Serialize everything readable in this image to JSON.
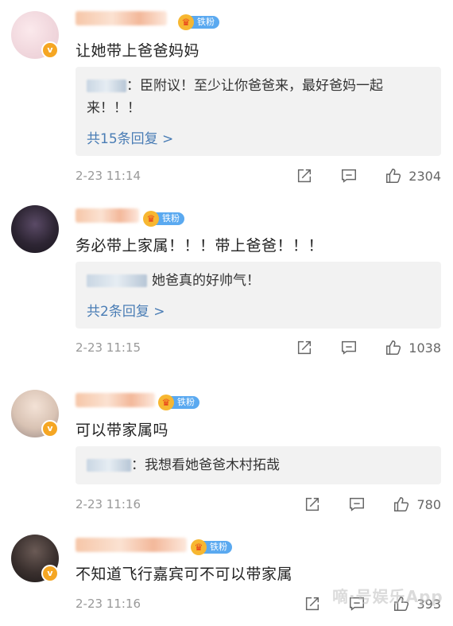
{
  "comments": [
    {
      "fan_badge": "铁粉",
      "text": "让她带上爸爸妈妈",
      "reply_preview": "：臣附议！至少让你爸爸来，最好爸妈一起",
      "reply_preview_cont": "来！！！",
      "reply_count": "共15条回复 >",
      "time": "2-23 11:14",
      "likes": "2304"
    },
    {
      "fan_badge": "铁粉",
      "text": "务必带上家属！！！带上爸爸！！！",
      "reply_preview": "她爸真的好帅气！",
      "reply_count": "共2条回复 >",
      "time": "2-23 11:15",
      "likes": "1038"
    },
    {
      "fan_badge": "铁粉",
      "text": "可以带家属吗",
      "reply_preview": "：我想看她爸爸木村拓哉",
      "time": "2-23 11:16",
      "likes": "780"
    },
    {
      "fan_badge": "铁粉",
      "text": "不知道飞行嘉宾可不可以带家属",
      "time": "2-23 11:16",
      "likes": "393"
    }
  ],
  "colors": {
    "link": "#4a7db5",
    "fan_tag": "#5aa9f0",
    "verified_badge": "#f5a623",
    "reply_bg": "#f2f2f2"
  },
  "icons": [
    "verified-badge-icon",
    "crown-icon",
    "share-icon",
    "comment-icon",
    "like-icon"
  ],
  "watermark": "嘀·号娱乐App"
}
